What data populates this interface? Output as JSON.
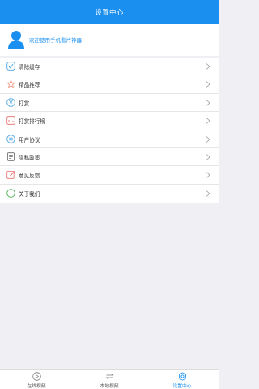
{
  "header": {
    "title": "设置中心"
  },
  "profile": {
    "welcome_text": "欢迎使用手机看片神器"
  },
  "menu": {
    "items": [
      {
        "label": "清除缓存",
        "icon": "clear-cache-icon",
        "color": "#4aa3df"
      },
      {
        "label": "精品推荐",
        "icon": "recommend-icon",
        "color": "#f08c7a"
      },
      {
        "label": "打赏",
        "icon": "reward-icon",
        "color": "#4aa3df"
      },
      {
        "label": "打赏排行榜",
        "icon": "ranking-icon",
        "color": "#e86a6a"
      },
      {
        "label": "用户协议",
        "icon": "agreement-icon",
        "color": "#4aa3df"
      },
      {
        "label": "隐私政策",
        "icon": "privacy-icon",
        "color": "#666666"
      },
      {
        "label": "意见反馈",
        "icon": "feedback-icon",
        "color": "#e86a6a"
      },
      {
        "label": "关于我们",
        "icon": "about-icon",
        "color": "#4caf50"
      }
    ]
  },
  "tabbar": {
    "tabs": [
      {
        "label": "在线视频",
        "icon": "play-icon",
        "active": false
      },
      {
        "label": "本地视频",
        "icon": "swap-icon",
        "active": false
      },
      {
        "label": "设置中心",
        "icon": "gear-icon",
        "active": true
      }
    ]
  },
  "colors": {
    "accent": "#1a8fef",
    "background": "#efeff4"
  }
}
